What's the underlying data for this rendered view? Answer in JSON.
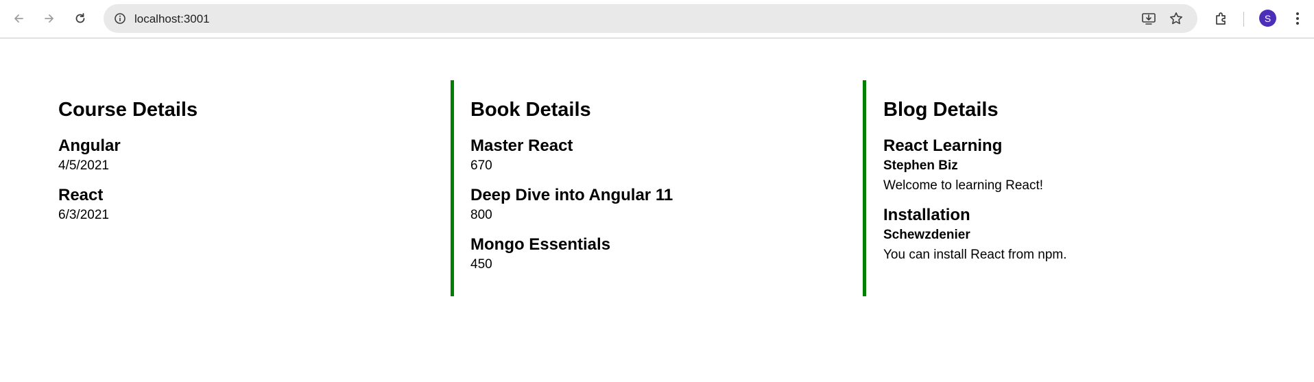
{
  "browser": {
    "url": "localhost:3001",
    "profile_initial": "S",
    "icons": {
      "back": "arrow-left-icon",
      "forward": "arrow-right-icon",
      "reload": "reload-icon",
      "site_info": "info-icon",
      "install": "install-app-icon",
      "bookmark": "star-icon",
      "extensions": "puzzle-icon",
      "menu": "kebab-menu-icon"
    },
    "colors": {
      "avatar": "#4b2fb8",
      "divider": "#008000"
    }
  },
  "courses": {
    "title": "Course Details",
    "items": [
      {
        "name": "Angular",
        "date": "4/5/2021"
      },
      {
        "name": "React",
        "date": "6/3/2021"
      }
    ]
  },
  "books": {
    "title": "Book Details",
    "items": [
      {
        "name": "Master React",
        "price": "670"
      },
      {
        "name": "Deep Dive into Angular 11",
        "price": "800"
      },
      {
        "name": "Mongo Essentials",
        "price": "450"
      }
    ]
  },
  "blogs": {
    "title": "Blog Details",
    "items": [
      {
        "title": "React Learning",
        "author": "Stephen Biz",
        "content": "Welcome to learning React!"
      },
      {
        "title": "Installation",
        "author": "Schewzdenier",
        "content": "You can install React from npm."
      }
    ]
  }
}
